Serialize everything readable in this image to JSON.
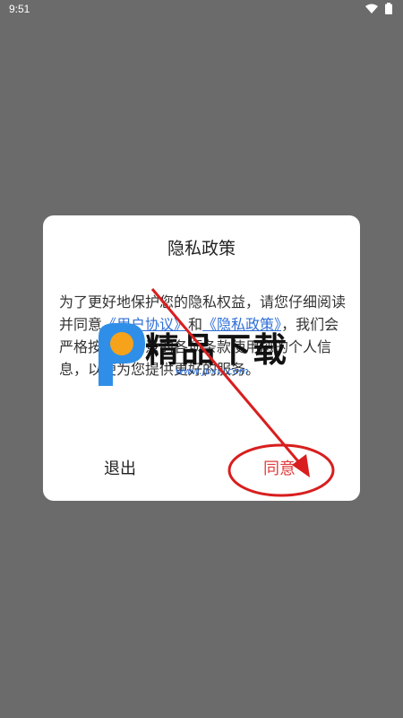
{
  "status_bar": {
    "time": "9:51",
    "icons": [
      "wifi-icon",
      "battery-icon"
    ]
  },
  "dialog": {
    "title": "隐私政策",
    "body": {
      "part1": "为了更好地保护您的隐私权益，请您仔细阅读并同意",
      "link_user_agreement": "《用户协议》",
      "and": "和",
      "link_privacy_policy": "《隐私政策》",
      "part2": "，我们会严格按照您同意的各项条款使用您的个人信息，以便为您提供更好的服务。"
    },
    "buttons": {
      "exit": "退出",
      "agree": "同意"
    }
  },
  "watermark": {
    "logo_text": "精品下载",
    "url": "www.jpxw.com"
  },
  "colors": {
    "backdrop": "#6b6b6b",
    "dialog_bg": "#ffffff",
    "link": "#2f6fd6",
    "agree": "#e23b3b",
    "annotation": "#d81e1e"
  }
}
